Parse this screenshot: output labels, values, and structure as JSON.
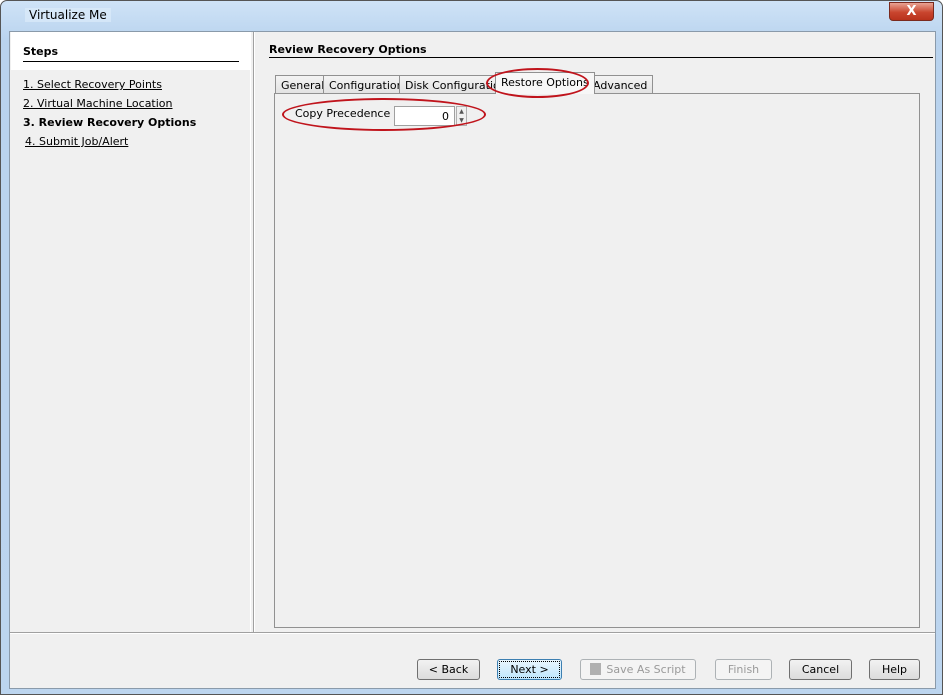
{
  "window": {
    "title": "Virtualize Me",
    "close_label": "X"
  },
  "steps": {
    "heading": "Steps",
    "items": [
      {
        "label": "1. Select Recovery Points",
        "current": false
      },
      {
        "label": "2. Virtual Machine Location",
        "current": false
      },
      {
        "label": "3. Review Recovery Options",
        "current": true
      },
      {
        "label": "4. Submit Job/Alert",
        "current": false
      }
    ]
  },
  "main": {
    "heading": "Review Recovery Options",
    "tabs": [
      {
        "label": "General"
      },
      {
        "label": "Configuration"
      },
      {
        "label": "Disk Configuration"
      },
      {
        "label": "Restore Options",
        "selected": true
      },
      {
        "label": "Advanced"
      }
    ],
    "copy_precedence": {
      "label": "Copy Precedence",
      "value": "0"
    }
  },
  "buttons": {
    "back": "< Back",
    "next": "Next >",
    "save_script": "Save As Script",
    "finish": "Finish",
    "cancel": "Cancel",
    "help": "Help"
  },
  "annotation_color": "#c0141c"
}
